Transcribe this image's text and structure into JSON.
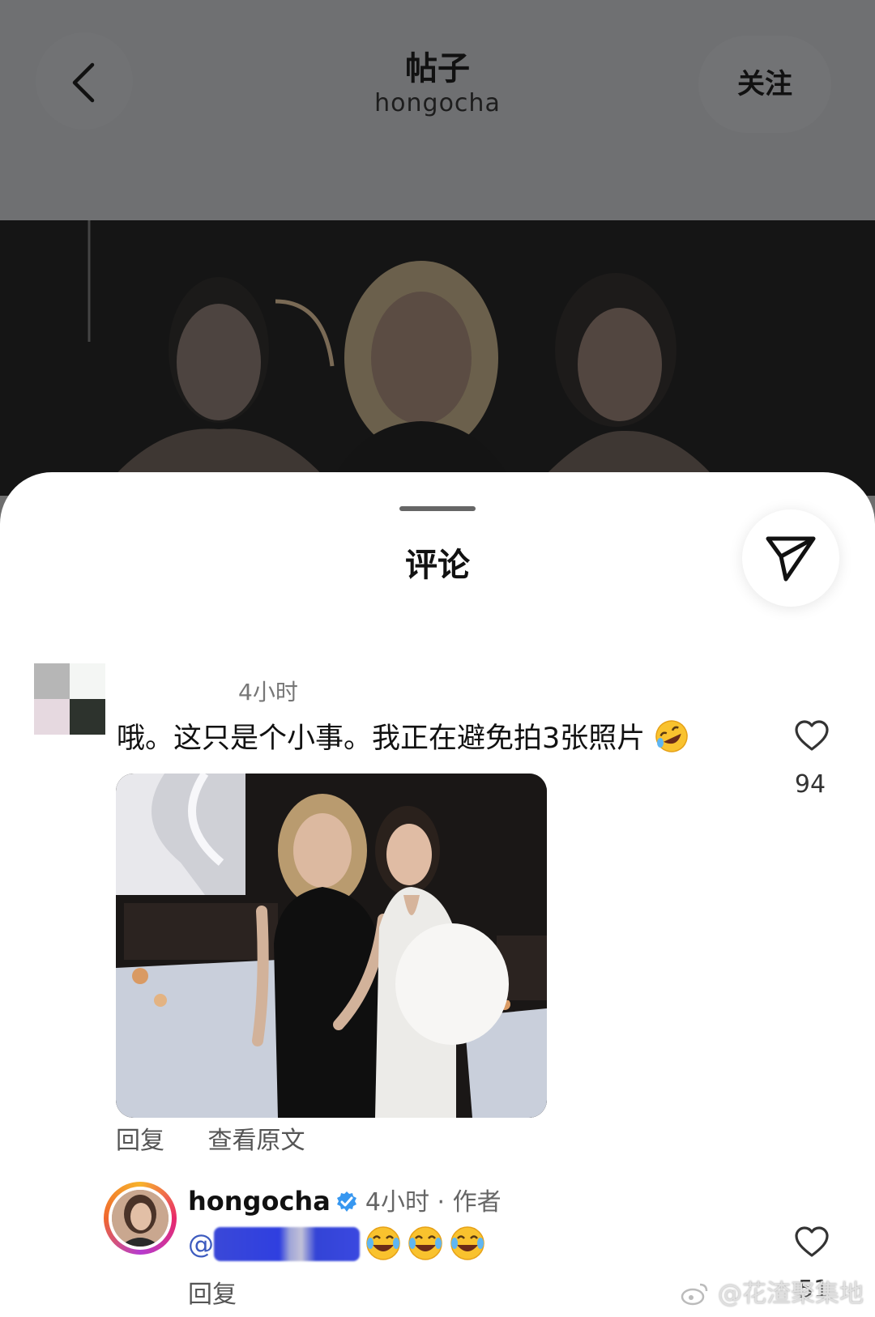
{
  "header": {
    "title": "帖子",
    "username": "hongocha",
    "follow_label": "关注"
  },
  "sheet": {
    "title": "评论"
  },
  "comments": [
    {
      "time": "4小时",
      "text": "哦。这只是个小事。我正在避免拍3张照片",
      "emoji": "rolling-on-floor-laughing-emoji",
      "likes": "94",
      "actions": [
        "回复",
        "查看原文"
      ]
    }
  ],
  "reply": {
    "username": "hongocha",
    "meta": "4小时 · 作者",
    "mention_prefix": "@",
    "emoji_count": 3,
    "reply_label": "回复",
    "likes": "51"
  },
  "watermark": "@花渣聚集地",
  "colors": {
    "header_bg": "#6f7072",
    "sheet_bg": "#ffffff",
    "verified": "#3797f0",
    "mention": "#3d5bbf"
  },
  "icons": [
    "back-chevron-icon",
    "send-icon",
    "heart-icon",
    "verified-badge-icon",
    "weibo-icon"
  ]
}
